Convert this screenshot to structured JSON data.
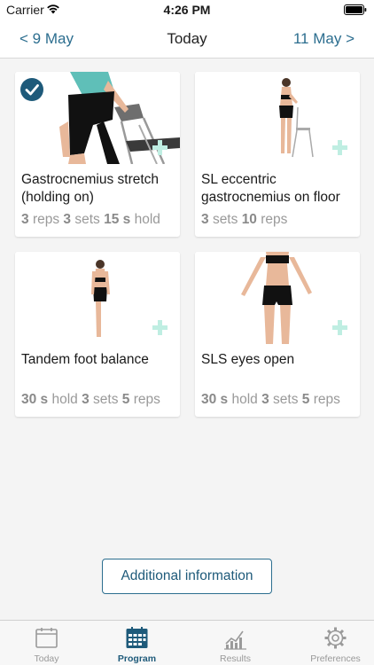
{
  "status": {
    "carrier": "Carrier",
    "time": "4:26 PM"
  },
  "nav": {
    "prev": "< 9 May",
    "title": "Today",
    "next": "11 May >"
  },
  "exercises": [
    {
      "title": "Gastrocnemius stretch (holding on)",
      "meta": [
        [
          "3",
          "reps"
        ],
        [
          "3",
          "sets"
        ],
        [
          "15 s",
          "hold"
        ]
      ],
      "completed": true
    },
    {
      "title": "SL eccentric gastrocnemius on floor",
      "meta": [
        [
          "3",
          "sets"
        ],
        [
          "10",
          "reps"
        ]
      ],
      "completed": false
    },
    {
      "title": "Tandem foot balance",
      "meta": [
        [
          "30 s",
          "hold"
        ],
        [
          "3",
          "sets"
        ],
        [
          "5",
          "reps"
        ]
      ],
      "completed": false
    },
    {
      "title": "SLS eyes open",
      "meta": [
        [
          "30 s",
          "hold"
        ],
        [
          "3",
          "sets"
        ],
        [
          "5",
          "reps"
        ]
      ],
      "completed": false
    }
  ],
  "additional_info_label": "Additional information",
  "tabs": [
    {
      "label": "Today",
      "icon": "calendar-icon",
      "active": false
    },
    {
      "label": "Program",
      "icon": "program-calendar-icon",
      "active": true
    },
    {
      "label": "Results",
      "icon": "chart-icon",
      "active": false
    },
    {
      "label": "Preferences",
      "icon": "gear-icon",
      "active": false
    }
  ],
  "colors": {
    "accent": "#1e5a7a",
    "plus": "#bfeee2",
    "muted": "#999999"
  }
}
